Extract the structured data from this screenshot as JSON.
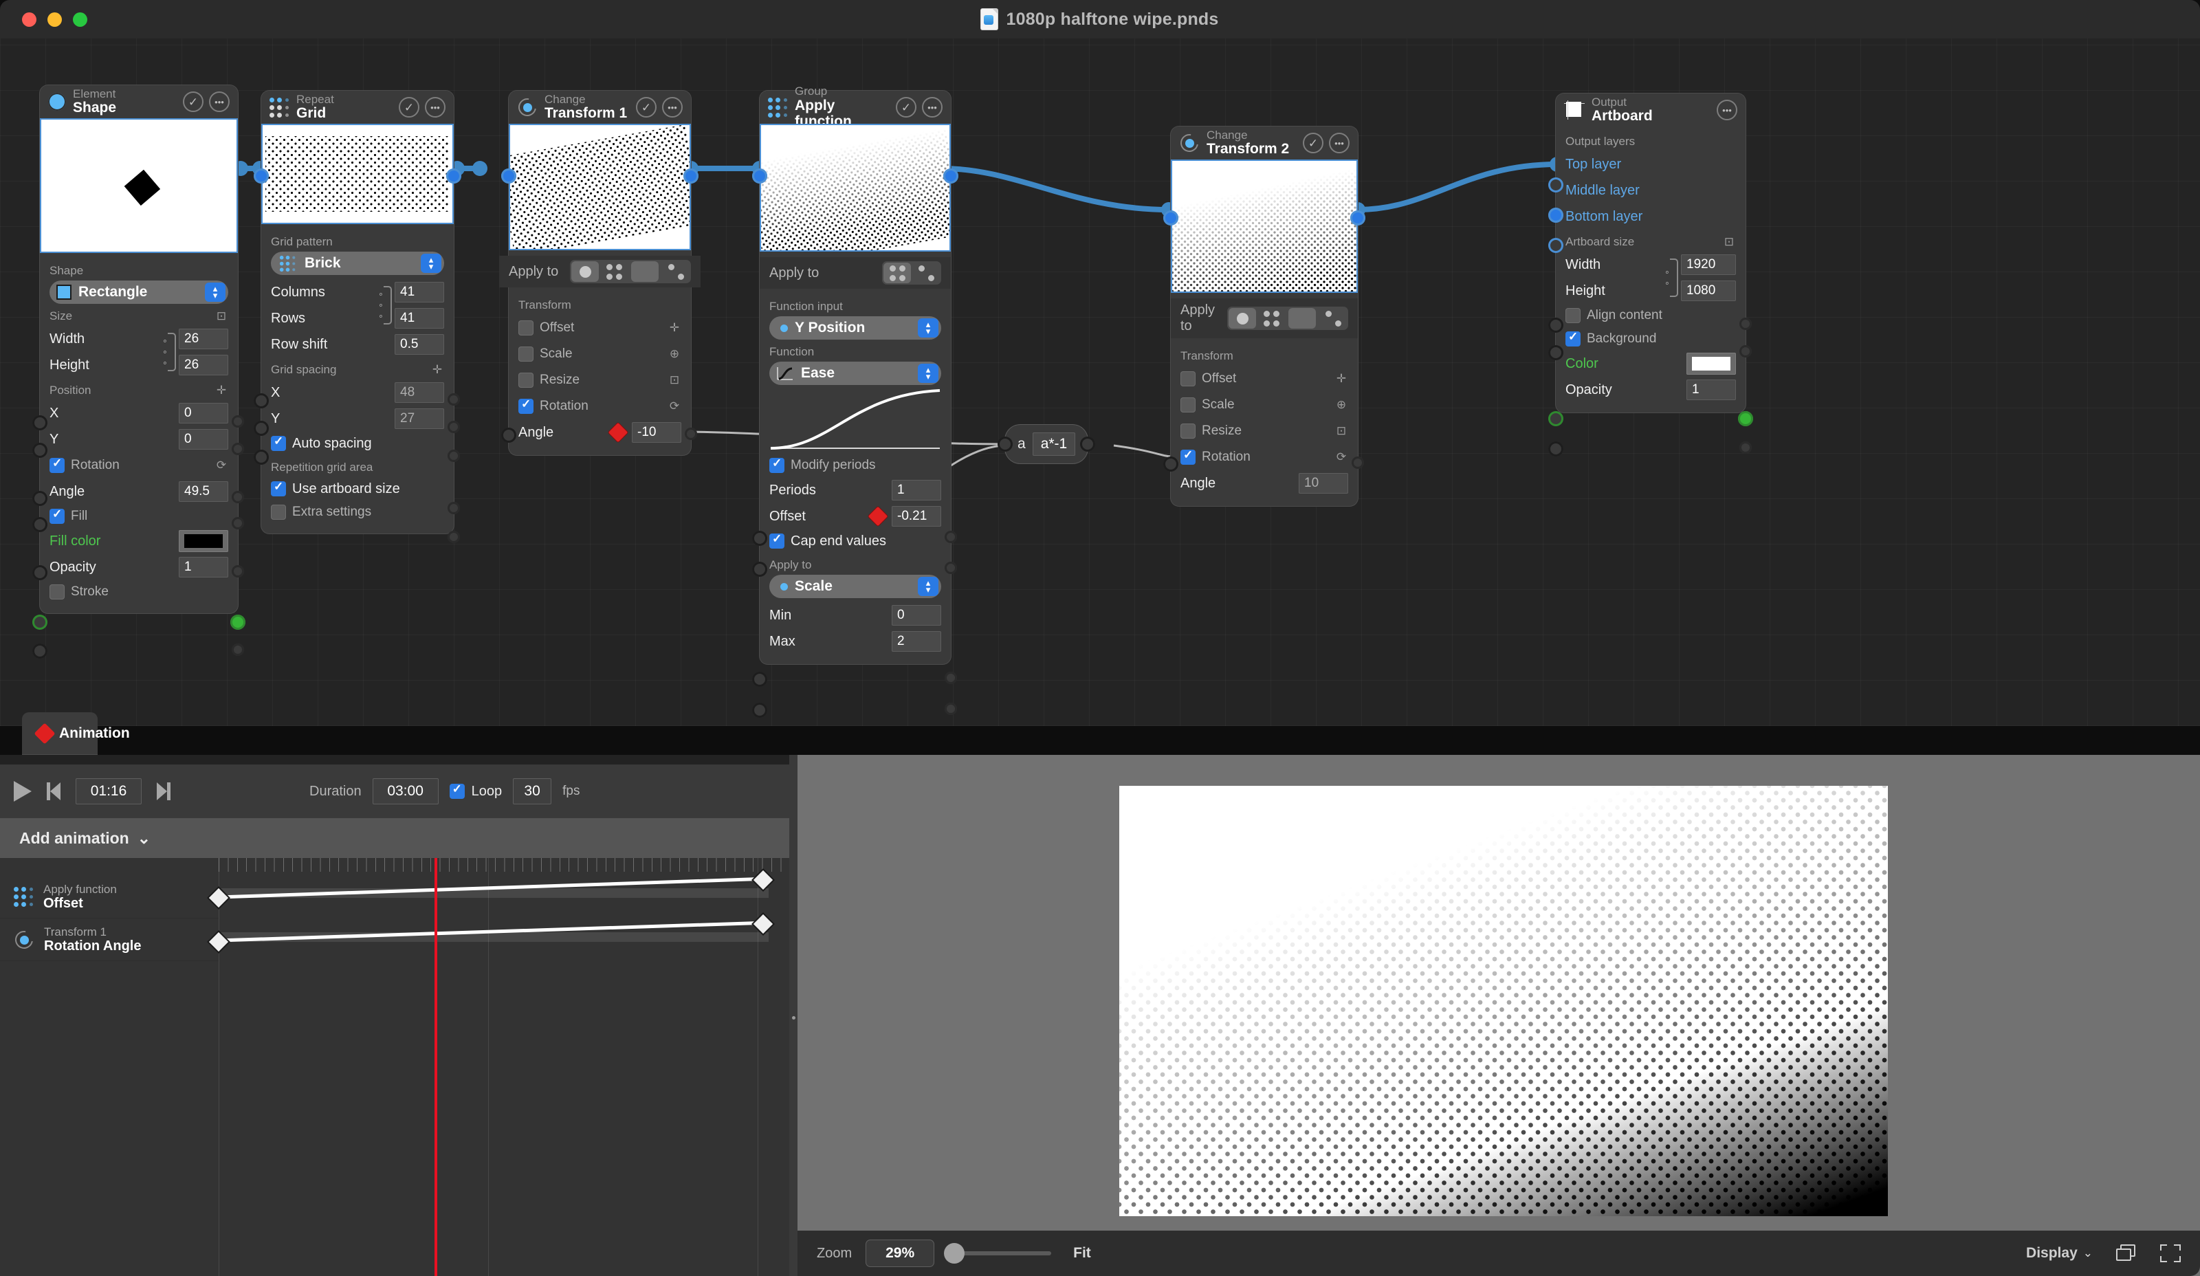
{
  "window": {
    "title": "1080p halftone wipe.pnds",
    "controls": [
      "close",
      "minimize",
      "zoom"
    ]
  },
  "nodes": {
    "shape": {
      "kind": "Element",
      "name": "Shape",
      "icon": "circle-blue-icon",
      "shape_label": "Shape",
      "shape_value": "Rectangle",
      "size_label": "Size",
      "width_label": "Width",
      "width_value": "26",
      "height_label": "Height",
      "height_value": "26",
      "position_label": "Position",
      "x_label": "X",
      "x_value": "0",
      "y_label": "Y",
      "y_value": "0",
      "rotation_label": "Rotation",
      "angle_label": "Angle",
      "angle_value": "49.5",
      "fill_label": "Fill",
      "fill_color_label": "Fill color",
      "fill_color_value": "#000000",
      "opacity_label": "Opacity",
      "opacity_value": "1",
      "stroke_label": "Stroke"
    },
    "grid": {
      "kind": "Repeat",
      "name": "Grid",
      "icon": "grid-dots-icon",
      "pattern_label": "Grid pattern",
      "pattern_value": "Brick",
      "columns_label": "Columns",
      "columns_value": "41",
      "rows_label": "Rows",
      "rows_value": "41",
      "row_shift_label": "Row shift",
      "row_shift_value": "0.5",
      "spacing_label": "Grid spacing",
      "spacing_x_label": "X",
      "spacing_x_value": "48",
      "spacing_y_label": "Y",
      "spacing_y_value": "27",
      "auto_spacing_label": "Auto spacing",
      "repetition_area_label": "Repetition grid area",
      "use_artboard_label": "Use artboard size",
      "extra_settings_label": "Extra settings"
    },
    "transform1": {
      "kind": "Change",
      "name": "Transform 1",
      "icon": "transform-icon",
      "apply_to_label": "Apply to",
      "transform_label": "Transform",
      "offset_label": "Offset",
      "scale_label": "Scale",
      "resize_label": "Resize",
      "rotation_label": "Rotation",
      "angle_label": "Angle",
      "angle_value": "-10"
    },
    "apply_function": {
      "kind": "Group",
      "name": "Apply function",
      "icon": "grid-dots-blue-icon",
      "apply_to_label": "Apply to",
      "function_input_label": "Function input",
      "function_input_value": "Y Position",
      "function_label": "Function",
      "function_value": "Ease",
      "modify_periods_label": "Modify periods",
      "periods_label": "Periods",
      "periods_value": "1",
      "offset_label": "Offset",
      "offset_value": "-0.21",
      "cap_end_values_label": "Cap end values",
      "apply_to2_label": "Apply to",
      "apply_to2_value": "Scale",
      "min_label": "Min",
      "min_value": "0",
      "max_label": "Max",
      "max_value": "2"
    },
    "expression": {
      "input_label": "a",
      "expression_value": "a*-1"
    },
    "transform2": {
      "kind": "Change",
      "name": "Transform 2",
      "icon": "transform-icon",
      "apply_to_label": "Apply to",
      "transform_label": "Transform",
      "offset_label": "Offset",
      "scale_label": "Scale",
      "resize_label": "Resize",
      "rotation_label": "Rotation",
      "angle_label": "Angle",
      "angle_value": "10"
    },
    "artboard": {
      "kind": "Output",
      "name": "Artboard",
      "icon": "artboard-icon",
      "output_layers_label": "Output layers",
      "top_layer_label": "Top layer",
      "middle_layer_label": "Middle layer",
      "bottom_layer_label": "Bottom layer",
      "artboard_size_label": "Artboard size",
      "width_label": "Width",
      "width_value": "1920",
      "height_label": "Height",
      "height_value": "1080",
      "align_content_label": "Align content",
      "background_label": "Background",
      "color_label": "Color",
      "color_value": "#ffffff",
      "opacity_label": "Opacity",
      "opacity_value": "1"
    }
  },
  "animation_panel": {
    "tab_label": "Animation",
    "current_time": "01:16",
    "duration_label": "Duration",
    "duration_value": "03:00",
    "loop_label": "Loop",
    "fps_value": "30",
    "fps_label": "fps",
    "add_animation_label": "Add animation",
    "tracks": [
      {
        "kind": "Apply function",
        "property": "Offset",
        "icon": "grid-dots-blue-icon"
      },
      {
        "kind": "Transform 1",
        "property": "Rotation Angle",
        "icon": "transform-icon"
      }
    ]
  },
  "preview": {
    "zoom_label": "Zoom",
    "zoom_value": "29%",
    "fit_label": "Fit",
    "display_label": "Display",
    "layers_icon": "layers-icon",
    "fullscreen_icon": "fullscreen-icon"
  },
  "colors": {
    "accent_blue": "#2a7ae4",
    "node_blue": "#5bb8f5",
    "cable_blue": "#3f88c5",
    "keyframe_red": "#e02020",
    "link_green": "#4ec64e",
    "panel_bg": "#3a3a3a",
    "canvas_bg": "#242424"
  }
}
